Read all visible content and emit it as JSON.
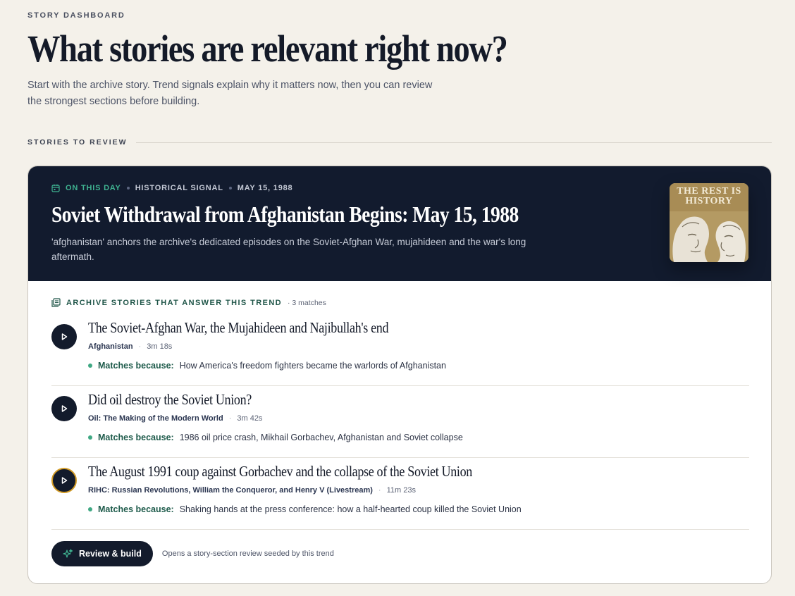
{
  "header": {
    "eyebrow": "STORY DASHBOARD",
    "title": "What stories are relevant right now?",
    "intro": "Start with the archive story. Trend signals explain why it matters now, then you can review the strongest sections before building."
  },
  "section": {
    "label": "STORIES TO REVIEW"
  },
  "trend": {
    "tag": "ON THIS DAY",
    "signal": "HISTORICAL SIGNAL",
    "date": "MAY 15, 1988",
    "title": "Soviet Withdrawal from Afghanistan Begins: May 15, 1988",
    "description": "'afghanistan' anchors the archive's dedicated episodes on the Soviet-Afghan War, mujahideen and the war's long aftermath.",
    "cover_text": "THE REST IS HISTORY"
  },
  "matches": {
    "label": "ARCHIVE STORIES THAT ANSWER THIS TREND",
    "count": "· 3 matches",
    "why_label": "Matches because:",
    "items": [
      {
        "title": "The Soviet-Afghan War, the Mujahideen and Najibullah's end",
        "show": "Afghanistan",
        "duration": "3m 18s",
        "reason": "How America's freedom fighters became the warlords of Afghanistan"
      },
      {
        "title": "Did oil destroy the Soviet Union?",
        "show": "Oil: The Making of the Modern World",
        "duration": "3m 42s",
        "reason": "1986 oil price crash, Mikhail Gorbachev, Afghanistan and Soviet collapse"
      },
      {
        "title": "The August 1991 coup against Gorbachev and the collapse of the Soviet Union",
        "show": "RIHC: Russian Revolutions, William the Conqueror, and Henry V (Livestream)",
        "duration": "11m 23s",
        "reason": "Shaking hands at the press conference: how a half-hearted coup killed the Soviet Union"
      }
    ]
  },
  "footer": {
    "button_label": "Review & build",
    "hint": "Opens a story-section review seeded by this trend"
  },
  "colors": {
    "background": "#f4f1ea",
    "navy": "#121b2e",
    "accent_green": "#3fb391",
    "active_ring": "#d29b26"
  },
  "icons": {
    "trend": "calendar-icon",
    "matches": "stack-icon",
    "play": "play-icon",
    "build": "sparkle-icon"
  }
}
